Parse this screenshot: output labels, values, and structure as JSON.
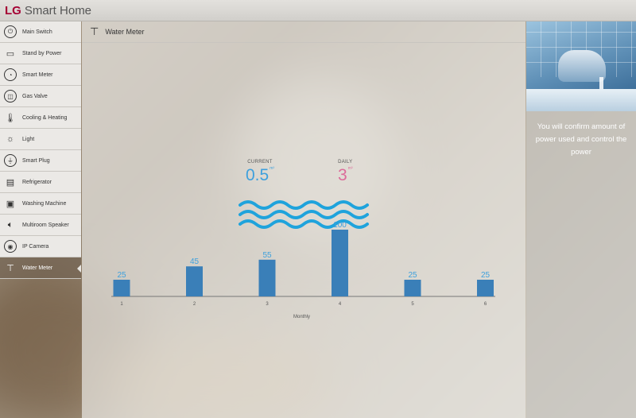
{
  "app": {
    "brand": "LG",
    "title": "Smart Home"
  },
  "sidebar": {
    "items": [
      {
        "label": "Main Switch",
        "icon": "power-icon"
      },
      {
        "label": "Stand by Power",
        "icon": "battery-icon"
      },
      {
        "label": "Smart Meter",
        "icon": "gauge-icon"
      },
      {
        "label": "Gas Valve",
        "icon": "valve-icon"
      },
      {
        "label": "Cooling & Heating",
        "icon": "thermometer-icon"
      },
      {
        "label": "Light",
        "icon": "light-bulb-icon"
      },
      {
        "label": "Smart Plug",
        "icon": "plug-icon"
      },
      {
        "label": "Refrigerator",
        "icon": "refrigerator-icon"
      },
      {
        "label": "Washing Machine",
        "icon": "washing-machine-icon"
      },
      {
        "label": "Multiroom Speaker",
        "icon": "speaker-icon"
      },
      {
        "label": "IP Camera",
        "icon": "camera-icon"
      },
      {
        "label": "Water Meter",
        "icon": "faucet-icon",
        "active": true
      }
    ]
  },
  "main": {
    "title": "Water Meter",
    "current": {
      "label": "CURRENT",
      "value": "0.5",
      "unit": "m³"
    },
    "daily": {
      "label": "DAILY",
      "value": "3",
      "unit": "m³"
    }
  },
  "right_panel": {
    "text": "You will confirm amount of power used and control the power"
  },
  "colors": {
    "brand": "#a50034",
    "current": "#3ea0dd",
    "daily": "#dc6c9a",
    "bar": "#3a7fb8",
    "wave": "#1fa3dc"
  },
  "chart_data": {
    "type": "bar",
    "categories": [
      "1",
      "2",
      "3",
      "4",
      "5",
      "6"
    ],
    "values": [
      25,
      45,
      55,
      100,
      25,
      25
    ],
    "xlabel": "Monthly",
    "ylabel": "",
    "ylim": [
      0,
      100
    ]
  }
}
